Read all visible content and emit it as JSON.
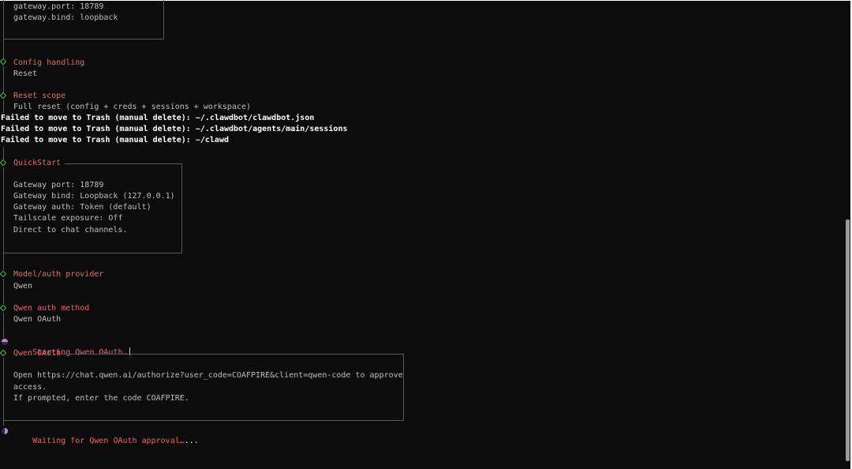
{
  "summary_box": {
    "lines": [
      "gateway.port: 18789",
      "gateway.bind: loopback"
    ]
  },
  "config_handling": {
    "title": "Config handling",
    "value": "Reset"
  },
  "reset_scope": {
    "title": "Reset scope",
    "value": "Full reset (config + creds + sessions + workspace)"
  },
  "errors": [
    "Failed to move to Trash (manual delete): ~/.clawdbot/clawdbot.json",
    "Failed to move to Trash (manual delete): ~/.clawdbot/agents/main/sessions",
    "Failed to move to Trash (manual delete): ~/clawd"
  ],
  "quickstart": {
    "title": "QuickStart",
    "lines": [
      "Gateway port: 18789",
      "Gateway bind: Loopback (127.0.0.1)",
      "Gateway auth: Token (default)",
      "Tailscale exposure: Off",
      "Direct to chat channels."
    ]
  },
  "model_provider": {
    "title": "Model/auth provider",
    "value": "Qwen"
  },
  "auth_method": {
    "title": "Qwen auth method",
    "value": "Qwen OAuth"
  },
  "starting_status": "Starting Qwen OAuth…",
  "qwen_oauth": {
    "title": "Qwen OAuth",
    "lines": [
      "Open https://chat.qwen.ai/authorize?user_code=COAFPIRE&client=qwen-code to approve",
      "access.",
      "If prompted, enter the code COAFPIRE."
    ]
  },
  "waiting_status": "Waiting for Qwen OAuth approval…",
  "waiting_dots": "...",
  "colors": {
    "background": "#0c0c0c",
    "heading": "#e06c6c",
    "diamond": "#3fbf3f",
    "spinner": "#b98ad8"
  },
  "icons": {
    "step_marker": "diamond-icon",
    "spinner": "spinner-icon"
  }
}
